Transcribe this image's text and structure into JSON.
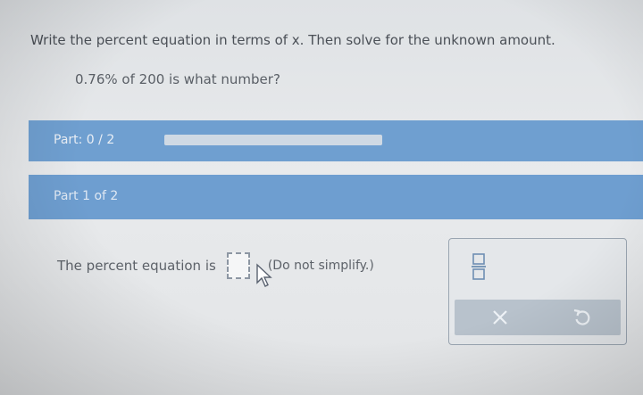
{
  "instruction": "Write the percent equation in terms of x. Then solve for the unknown amount.",
  "question": "0.76% of 200 is what number?",
  "progress": {
    "label": "Part: 0 / 2",
    "fraction": 0.0
  },
  "part": {
    "label": "Part 1 of 2"
  },
  "equation": {
    "label": "The percent equation is",
    "hint": "(Do not simplify.)"
  },
  "tools": {
    "fraction_icon": "fraction-icon",
    "clear_icon": "x-icon",
    "undo_icon": "undo-icon"
  },
  "colors": {
    "bar": "#6f9fd0",
    "background": "#e6e8ea"
  }
}
